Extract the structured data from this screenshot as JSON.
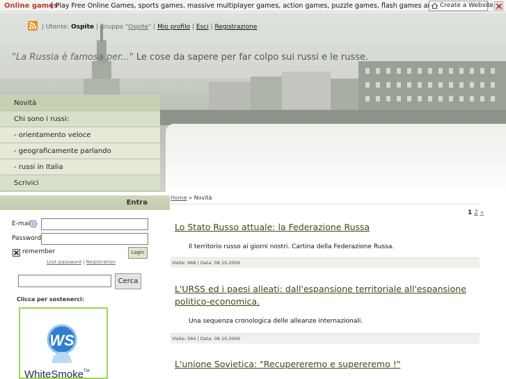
{
  "adbar": {
    "brand": "Online games",
    "promo": "[ Play Free Online Games, sports games, massive multiplayer games, action games, puzzle games, flash games and more. ]",
    "create_label": "Create a Website"
  },
  "userbar": {
    "sep1": " | Utente: ",
    "user": "Ospite",
    "sep2": " | Gruppo \"",
    "group": "Ospite",
    "sep3": "\" | ",
    "profile": "Mio profilo",
    "sep4": " | ",
    "logout": "Esci",
    "sep5": " | ",
    "register": "Registrazione"
  },
  "tagline": {
    "quote": "\"La Russia è famosa per...\"",
    "rest": " Le cose da sapere per far colpo sui russi e le russe."
  },
  "menu": {
    "items": [
      {
        "label": "Novità"
      },
      {
        "label": "Chi sono i russi:"
      },
      {
        "label": "- orientamento veloce"
      },
      {
        "label": "- geograficamente parlando"
      },
      {
        "label": "- russi in Italia"
      },
      {
        "label": "Scrivici"
      }
    ]
  },
  "login": {
    "header": "Entra",
    "email_label": "E-mail:",
    "email_value": "",
    "password_label": "Password:",
    "password_value": "",
    "remember_label": "remember",
    "login_button": "Login",
    "lost_password": "Lost password",
    "link_sep": " | ",
    "registration": "Registration"
  },
  "search": {
    "value": "",
    "button": "Cerca"
  },
  "support": {
    "label": "Clicca per sostenerci:",
    "banner_text": "WhiteSmoke",
    "banner_mark": "TM"
  },
  "breadcrumb": {
    "home": "Home",
    "sep": " » ",
    "current": "Novità"
  },
  "pager": {
    "current": "1",
    "next_page": "2",
    "next": "»"
  },
  "articles": [
    {
      "title": "Lo Stato Russo attuale: la Federazione Russa",
      "body": "Il territorio russo ai giorni nostri. Cartina della Federazione Russa.",
      "meta": "Visite: 668 | Data: 08.10.2009"
    },
    {
      "title": "L'URSS ed i paesi alleati: dall'espansione territoriale all'espansione politico-economica.",
      "body": "Una sequenza cronologica delle alleanze internazionali.",
      "meta": "Visite: 564 | Data: 08.10.2009"
    },
    {
      "title": "L'unione Sovietica: \"Recupereremo e supereremo !\"",
      "body": "",
      "meta": ""
    }
  ],
  "colors": {
    "brand_red": "#c0392b",
    "menu_green": "#d9e0c9",
    "article_link": "#3a4a12",
    "rss_orange": "#f08a24"
  }
}
